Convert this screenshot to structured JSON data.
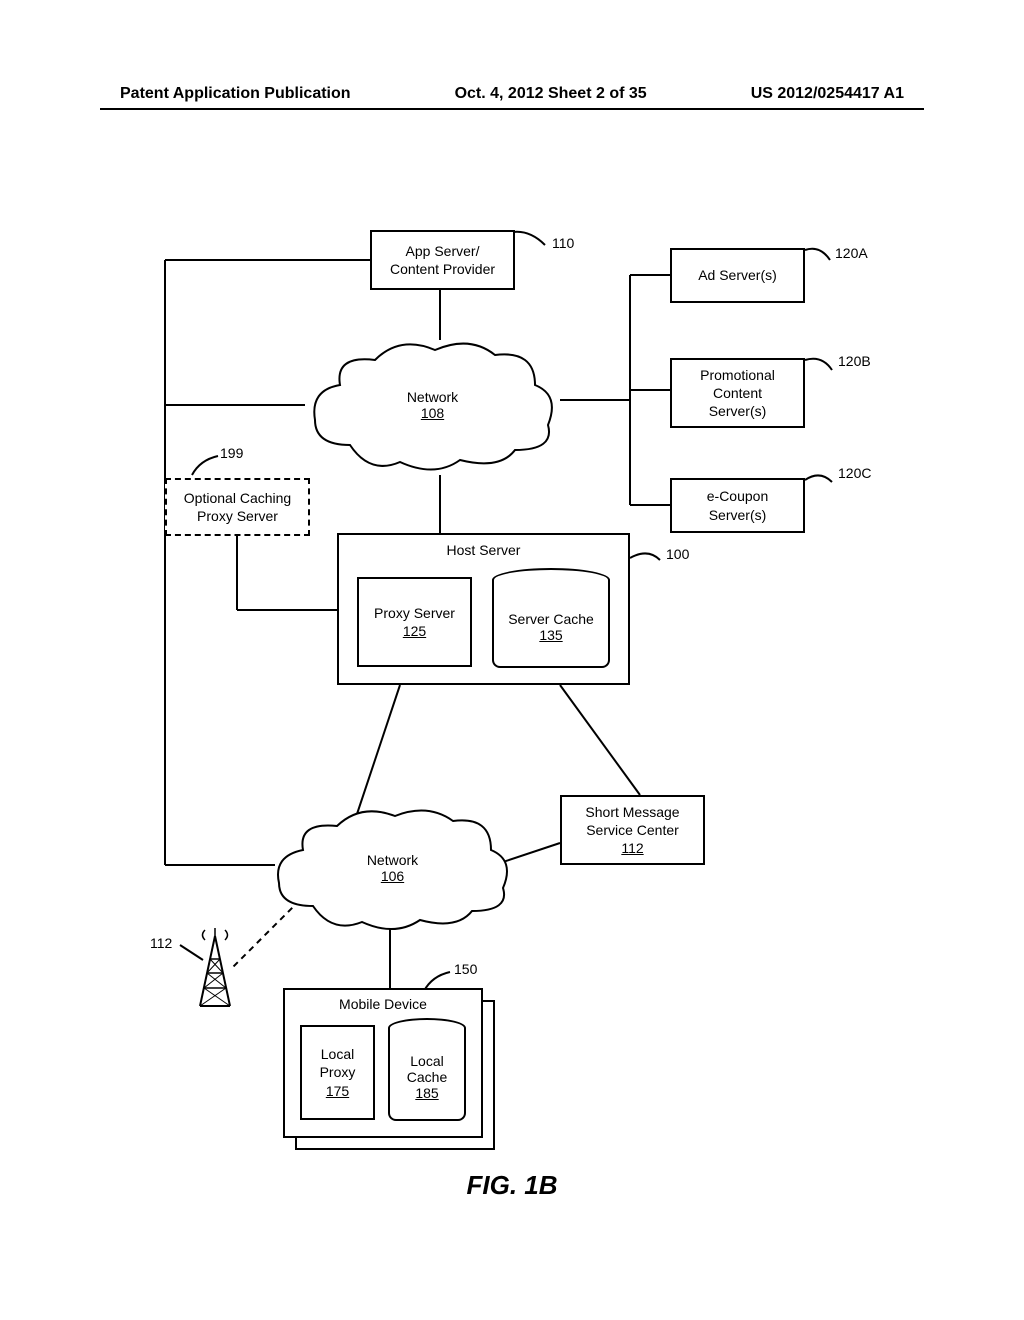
{
  "header": {
    "left": "Patent Application Publication",
    "center": "Oct. 4, 2012  Sheet 2 of 35",
    "right": "US 2012/0254417 A1"
  },
  "figure_label": "FIG. 1B",
  "boxes": {
    "app_server": {
      "line1": "App Server/",
      "line2": "Content Provider",
      "ref": "110"
    },
    "ad_server": {
      "line1": "Ad Server(s)",
      "ref": "120A"
    },
    "promo_server": {
      "line1": "Promotional",
      "line2": "Content",
      "line3": "Server(s)",
      "ref": "120B"
    },
    "ecoupon_server": {
      "line1": "e-Coupon",
      "line2": "Server(s)",
      "ref": "120C"
    },
    "caching_proxy": {
      "line1": "Optional Caching",
      "line2": "Proxy Server",
      "ref": "199"
    },
    "host_server": {
      "title": "Host Server",
      "ref": "100"
    },
    "proxy_server": {
      "line1": "Proxy Server",
      "ref": "125"
    },
    "server_cache": {
      "line1": "Server Cache",
      "ref": "135"
    },
    "smsc": {
      "line1": "Short Message",
      "line2": "Service Center",
      "ref": "112"
    },
    "mobile_device": {
      "title": "Mobile Device",
      "ref": "150"
    },
    "local_proxy": {
      "line1": "Local",
      "line2": "Proxy",
      "ref": "175"
    },
    "local_cache": {
      "line1": "Local",
      "line2": "Cache",
      "ref": "185"
    },
    "tower": {
      "ref": "112"
    }
  },
  "clouds": {
    "network108": {
      "label": "Network",
      "ref": "108"
    },
    "network106": {
      "label": "Network",
      "ref": "106"
    }
  }
}
